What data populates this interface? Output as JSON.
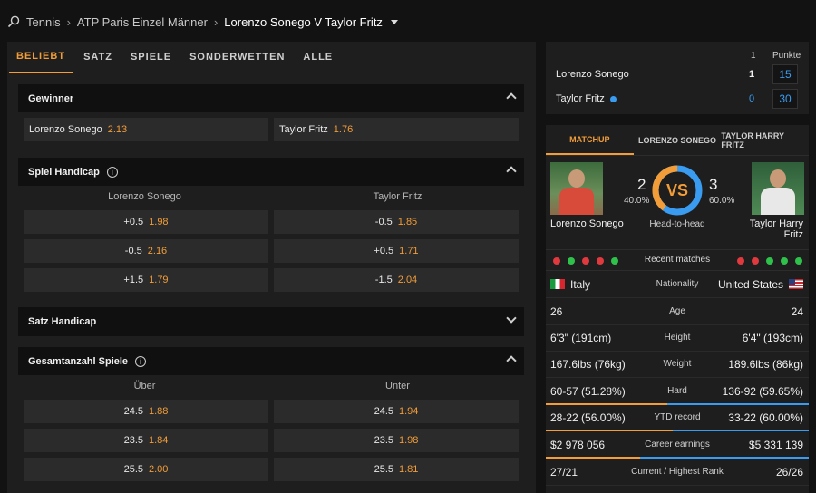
{
  "breadcrumb": {
    "sport": "Tennis",
    "tournament": "ATP Paris Einzel Männer",
    "match": "Lorenzo Sonego V Taylor Fritz"
  },
  "tabs": [
    "BELIEBT",
    "SATZ",
    "SPIELE",
    "SONDERWETTEN",
    "ALLE"
  ],
  "markets": {
    "winner": {
      "title": "Gewinner",
      "p1": "Lorenzo Sonego",
      "o1": "2.13",
      "p2": "Taylor Fritz",
      "o2": "1.76"
    },
    "game_handicap": {
      "title": "Spiel Handicap",
      "col1": "Lorenzo Sonego",
      "col2": "Taylor Fritz",
      "rows": [
        {
          "l": "+0.5",
          "lo": "1.98",
          "r": "-0.5",
          "ro": "1.85"
        },
        {
          "l": "-0.5",
          "lo": "2.16",
          "r": "+0.5",
          "ro": "1.71"
        },
        {
          "l": "+1.5",
          "lo": "1.79",
          "r": "-1.5",
          "ro": "2.04"
        }
      ]
    },
    "set_handicap": {
      "title": "Satz Handicap"
    },
    "total_games": {
      "title": "Gesamtanzahl Spiele",
      "col1": "Über",
      "col2": "Unter",
      "rows": [
        {
          "l": "24.5",
          "lo": "1.88",
          "r": "24.5",
          "ro": "1.94"
        },
        {
          "l": "23.5",
          "lo": "1.84",
          "r": "23.5",
          "ro": "1.98"
        },
        {
          "l": "25.5",
          "lo": "2.00",
          "r": "25.5",
          "ro": "1.81"
        }
      ]
    }
  },
  "scoreboard": {
    "set_header": "1",
    "points_header": "Punkte",
    "p1": {
      "name": "Lorenzo Sonego",
      "set": "1",
      "points": "15"
    },
    "p2": {
      "name": "Taylor Fritz",
      "set": "0",
      "points": "30"
    }
  },
  "matchup": {
    "tabs": [
      "MATCHUP",
      "LORENZO SONEGO",
      "TAYLOR HARRY FRITZ"
    ],
    "p1": {
      "name": "Lorenzo Sonego",
      "wins": "2",
      "pct": "40.0%"
    },
    "p2": {
      "name_line1": "Taylor Harry",
      "name_line2": "Fritz",
      "wins": "3",
      "pct": "60.0%"
    },
    "vs": "VS",
    "h2h_label": "Head-to-head",
    "h2h_share_p1": 0.4,
    "recent_label": "Recent matches",
    "recent_p1": [
      "L",
      "W",
      "L",
      "L",
      "W"
    ],
    "recent_p2": [
      "L",
      "L",
      "W",
      "W",
      "W"
    ],
    "nationality": {
      "label": "Nationality",
      "p1": "Italy",
      "p2": "United States"
    },
    "stats": [
      {
        "label": "Age",
        "p1": "26",
        "p2": "24"
      },
      {
        "label": "Height",
        "p1": "6'3\" (191cm)",
        "p2": "6'4\" (193cm)"
      },
      {
        "label": "Weight",
        "p1": "167.6lbs (76kg)",
        "p2": "189.6lbs (86kg)"
      },
      {
        "label": "Hard",
        "p1": "60-57 (51.28%)",
        "p2": "136-92 (59.65%)",
        "share": 0.462
      },
      {
        "label": "YTD record",
        "p1": "28-22 (56.00%)",
        "p2": "33-22 (60.00%)",
        "share": 0.483
      },
      {
        "label": "Career earnings",
        "p1": "$2 978 056",
        "p2": "$5 331 139",
        "share": 0.358
      },
      {
        "label": "Current / Highest Rank",
        "p1": "27/21",
        "p2": "26/26"
      }
    ],
    "colors": {
      "p1": "#f29d38",
      "p2": "#3a9cf0"
    }
  }
}
